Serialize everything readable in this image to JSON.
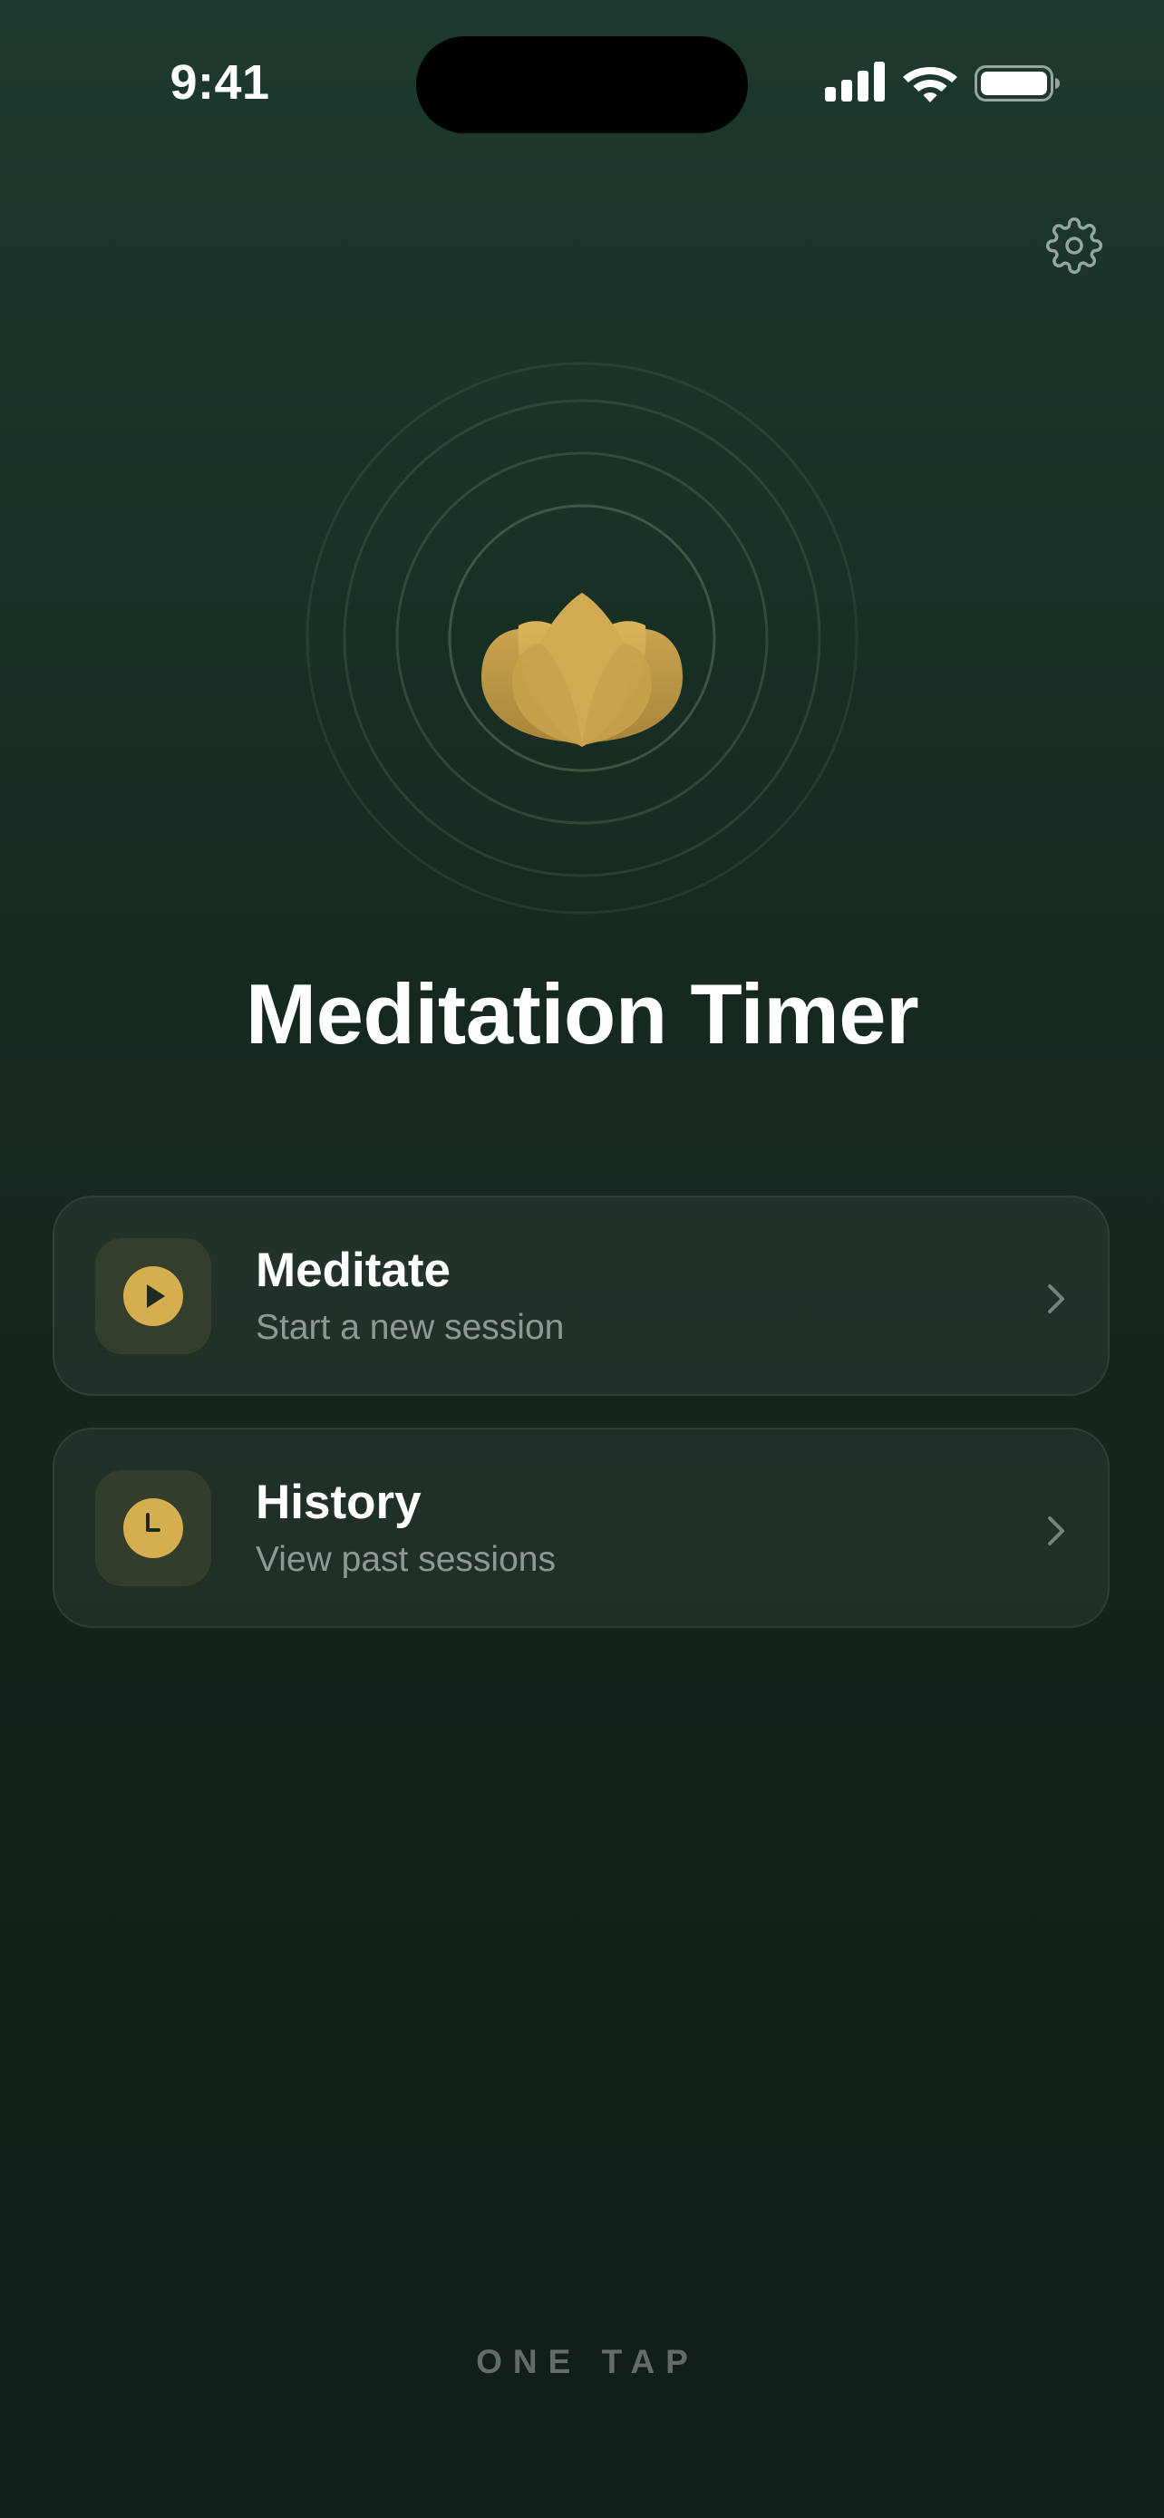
{
  "status_bar": {
    "time": "9:41",
    "icons": [
      "cellular-signal-icon",
      "wifi-icon",
      "battery-icon"
    ]
  },
  "header": {
    "settings_icon": "gear-icon"
  },
  "hero": {
    "logo_icon": "lotus-icon",
    "title": "Meditation Timer"
  },
  "menu": {
    "items": [
      {
        "icon": "play-icon",
        "title": "Meditate",
        "subtitle": "Start a new session",
        "chevron": "chevron-right-icon"
      },
      {
        "icon": "clock-icon",
        "title": "History",
        "subtitle": "View past sessions",
        "chevron": "chevron-right-icon"
      }
    ]
  },
  "footer": {
    "text": "ONE TAP"
  },
  "colors": {
    "background_top": "#1c3a2d",
    "background_bottom": "#111d17",
    "accent_gold": "#d4ae4f",
    "text_primary": "#ffffff"
  }
}
